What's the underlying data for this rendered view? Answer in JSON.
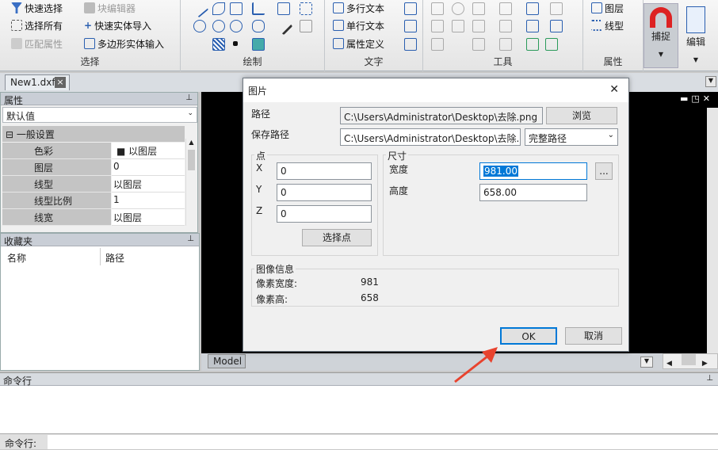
{
  "ribbon": {
    "select_group": {
      "label": "选择",
      "items": [
        "快速选择",
        "块编辑器",
        "选择所有",
        "快速实体导入",
        "匹配属性",
        "多边形实体输入"
      ]
    },
    "draw_group": {
      "label": "绘制"
    },
    "text_group": {
      "label": "文字",
      "items": [
        "多行文本",
        "单行文本",
        "属性定义"
      ]
    },
    "tools_group": {
      "label": "工具"
    },
    "attr_group": {
      "label": "属性",
      "items": [
        "图层",
        "线型"
      ]
    },
    "snap": {
      "label": "捕捉"
    },
    "edit": {
      "label": "编辑"
    }
  },
  "doc_tab": {
    "name": "New1.dxf",
    "close": "×"
  },
  "properties": {
    "title": "属性",
    "pin": "⬝",
    "preset": "默认值",
    "section": "一般设置",
    "rows": [
      {
        "k": "色彩",
        "v": "以图层"
      },
      {
        "k": "图层",
        "v": "0"
      },
      {
        "k": "线型",
        "v": "以图层"
      },
      {
        "k": "线型比例",
        "v": "1"
      },
      {
        "k": "线宽",
        "v": "以图层"
      }
    ]
  },
  "favorites": {
    "title": "收藏夹",
    "col_name": "名称",
    "col_path": "路径"
  },
  "model_tab": "Model",
  "command": {
    "title": "命令行",
    "prompt": "命令行:"
  },
  "dialog": {
    "title": "图片",
    "close": "✕",
    "path_label": "路径",
    "path_value": "C:\\Users\\Administrator\\Desktop\\去除.png",
    "browse": "浏览",
    "save_label": "保存路径",
    "save_value": "C:\\Users\\Administrator\\Desktop\\去除.png",
    "save_mode": "完整路径",
    "point": {
      "legend": "点",
      "x_label": "X",
      "x": "0",
      "y_label": "Y",
      "y": "0",
      "z_label": "Z",
      "z": "0",
      "pick": "选择点"
    },
    "size": {
      "legend": "尺寸",
      "w_label": "宽度",
      "w": "981.00",
      "h_label": "高度",
      "h": "658.00",
      "dots": "..."
    },
    "info": {
      "legend": "图像信息",
      "pw_label": "像素宽度:",
      "pw": "981",
      "ph_label": "像素高:",
      "ph": "658"
    },
    "ok": "OK",
    "cancel": "取消"
  },
  "colors": {
    "accent": "#0078d7",
    "arrow": "#e8432e"
  }
}
